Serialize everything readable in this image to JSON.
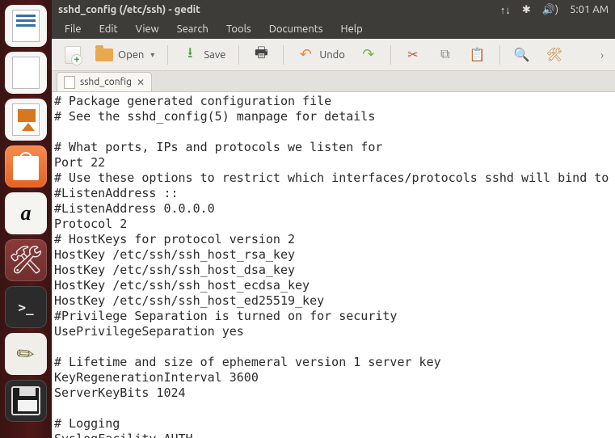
{
  "window_title": "sshd_config (/etc/ssh) - gedit",
  "status": {
    "net_icon": "↑↓",
    "bt_icon": "✱",
    "sound_icon": "🔊)",
    "time": "5:01 AM"
  },
  "menus": [
    "File",
    "Edit",
    "View",
    "Search",
    "Tools",
    "Documents",
    "Help"
  ],
  "toolbar": {
    "open_label": "Open",
    "save_label": "Save",
    "undo_label": "Undo"
  },
  "tab": {
    "filename": "sshd_config"
  },
  "editor_text": "# Package generated configuration file\n# See the sshd_config(5) manpage for details\n\n# What ports, IPs and protocols we listen for\nPort 22\n# Use these options to restrict which interfaces/protocols sshd will bind to\n#ListenAddress ::\n#ListenAddress 0.0.0.0\nProtocol 2\n# HostKeys for protocol version 2\nHostKey /etc/ssh/ssh_host_rsa_key\nHostKey /etc/ssh/ssh_host_dsa_key\nHostKey /etc/ssh/ssh_host_ecdsa_key\nHostKey /etc/ssh/ssh_host_ed25519_key\n#Privilege Separation is turned on for security\nUsePrivilegeSeparation yes\n\n# Lifetime and size of ephemeral version 1 server key\nKeyRegenerationInterval 3600\nServerKeyBits 1024\n\n# Logging\nSyslogFacility AUTH\nLogLevel INFO"
}
